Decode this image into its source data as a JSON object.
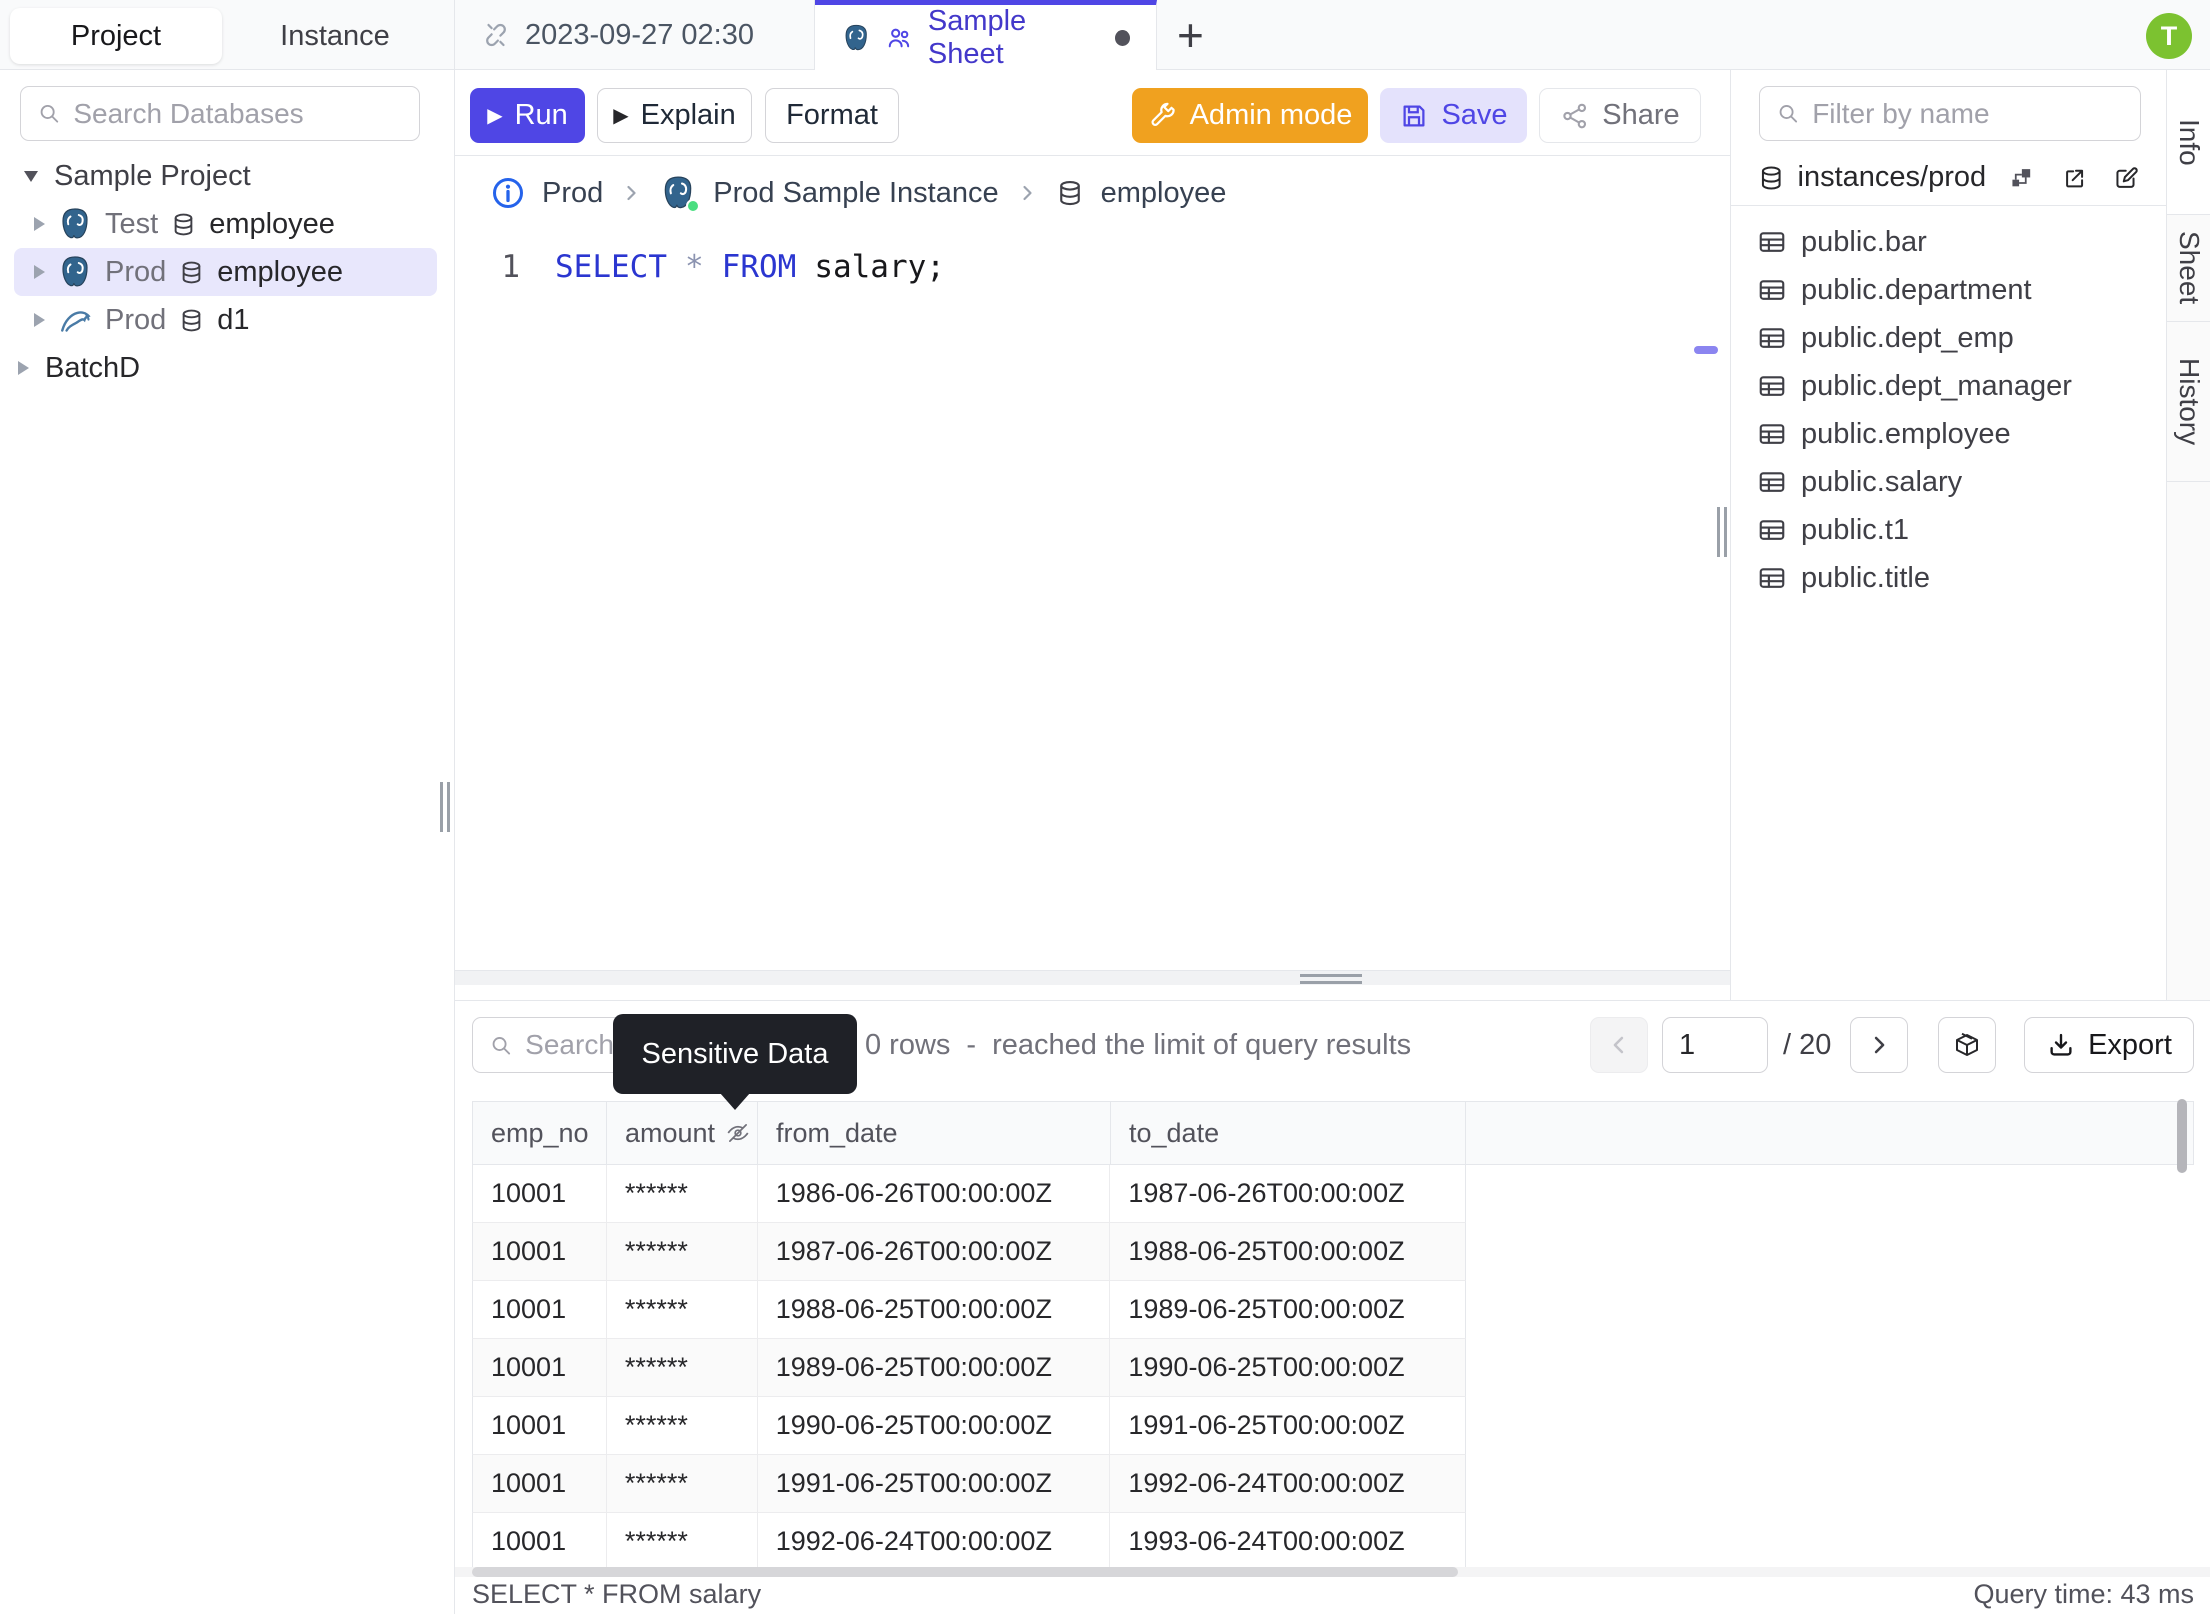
{
  "sidebar": {
    "project_tab": "Project",
    "instance_tab": "Instance",
    "search_placeholder": "Search Databases",
    "project_name": "Sample Project",
    "databases": [
      {
        "env": "Test",
        "name": "employee"
      },
      {
        "env": "Prod",
        "name": "employee"
      },
      {
        "env": "Prod",
        "name": "d1"
      }
    ],
    "batch_item": "BatchD"
  },
  "sheet_tabs": {
    "tab1": "2023-09-27 02:30",
    "tab2": "Sample Sheet",
    "add": "+"
  },
  "user": {
    "avatar_initial": "T"
  },
  "toolbar": {
    "run": "Run",
    "explain": "Explain",
    "format": "Format",
    "admin_mode": "Admin mode",
    "save": "Save",
    "share": "Share"
  },
  "breadcrumb": {
    "environment": "Prod",
    "instance": "Prod Sample Instance",
    "database": "employee"
  },
  "editor": {
    "line_number": "1",
    "keyword_select": "SELECT",
    "star": "*",
    "keyword_from": "FROM",
    "tail": "salary;"
  },
  "schema_panel": {
    "filter_placeholder": "Filter by name",
    "connection": "instances/prod",
    "tables": [
      "public.bar",
      "public.department",
      "public.dept_emp",
      "public.dept_manager",
      "public.employee",
      "public.salary",
      "public.t1",
      "public.title"
    ]
  },
  "right_tabs": {
    "info": "Info",
    "sheet": "Sheet",
    "history": "History"
  },
  "results": {
    "search_placeholder": "Search",
    "tooltip": "Sensitive Data",
    "row_count": "0 rows",
    "dash": "-",
    "limit_message": "reached the limit of query results",
    "page_value": "1",
    "page_total": "/ 20",
    "export": "Export",
    "columns": {
      "c0": "emp_no",
      "c1": "amount",
      "c2": "from_date",
      "c3": "to_date"
    },
    "rows": [
      [
        "10001",
        "******",
        "1986-06-26T00:00:00Z",
        "1987-06-26T00:00:00Z"
      ],
      [
        "10001",
        "******",
        "1987-06-26T00:00:00Z",
        "1988-06-25T00:00:00Z"
      ],
      [
        "10001",
        "******",
        "1988-06-25T00:00:00Z",
        "1989-06-25T00:00:00Z"
      ],
      [
        "10001",
        "******",
        "1989-06-25T00:00:00Z",
        "1990-06-25T00:00:00Z"
      ],
      [
        "10001",
        "******",
        "1990-06-25T00:00:00Z",
        "1991-06-25T00:00:00Z"
      ],
      [
        "10001",
        "******",
        "1991-06-25T00:00:00Z",
        "1992-06-24T00:00:00Z"
      ],
      [
        "10001",
        "******",
        "1992-06-24T00:00:00Z",
        "1993-06-24T00:00:00Z"
      ]
    ],
    "status_query": "SELECT * FROM salary",
    "status_time": "Query time: 43 ms"
  },
  "colors": {
    "accent": "#4f46e5",
    "admin_orange": "#f0a11f",
    "avatar_green": "#7cc230",
    "tooltip_bg": "#1f2127",
    "selection_bg": "#e8e7fc"
  }
}
